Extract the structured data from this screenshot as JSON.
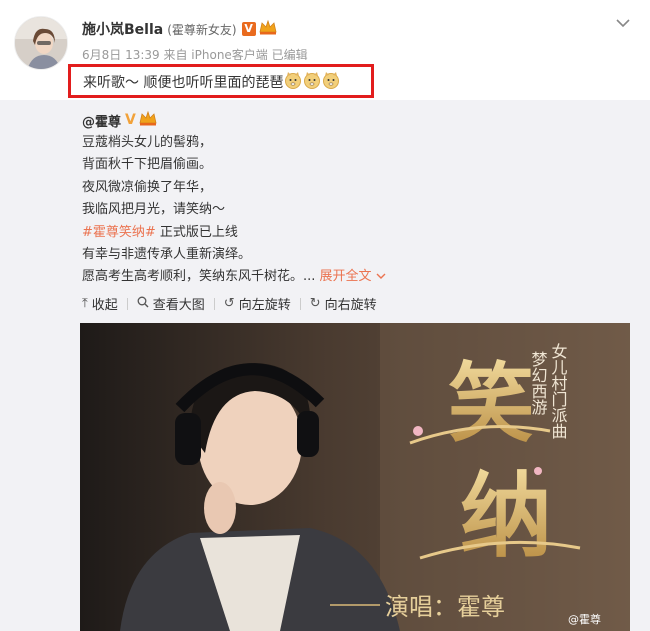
{
  "post": {
    "username": "施小岚Bella",
    "relation": "(霍尊新女友)",
    "verified_badge": "V",
    "meta": "6月8日 13:39 来自 iPhone客户端 已编辑",
    "text": "来听歌～ 顺便也听听里面的琵琶",
    "emojis": [
      "doge",
      "doge",
      "doge"
    ],
    "menu_icon": "chevron-down"
  },
  "repost": {
    "author": "@霍尊",
    "badge": "V",
    "lines": [
      "豆蔻梢头女儿的髻鸦，",
      "背面秋千下把眉偷画。",
      "夜风微凉偷换了年华，",
      "我临风把月光，请笑纳～"
    ],
    "hashtag": "#霍尊笑纳#",
    "hashtag_suffix": " 正式版已上线",
    "lines2": [
      "有幸与非遗传承人重新演绎。"
    ],
    "last_line": "愿高考生高考顺利，笑纳东风千树花。...",
    "expand_label": "展开全文",
    "toolbar": {
      "collapse": "收起",
      "view_large": "查看大图",
      "rotate_left": "向左旋转",
      "rotate_right": "向右旋转"
    }
  },
  "poster": {
    "title_char_1": "笑",
    "title_char_2": "纳",
    "side_col_1": "梦幻西游",
    "side_col_2": "女儿村门派曲",
    "credit": "演唱：霍尊",
    "watermark": "@霍尊"
  },
  "colors": {
    "highlight_border": "#e21d1d",
    "link": "#eb7350",
    "repost_bg": "#f2f2f5",
    "gold": "#c9a35b"
  }
}
